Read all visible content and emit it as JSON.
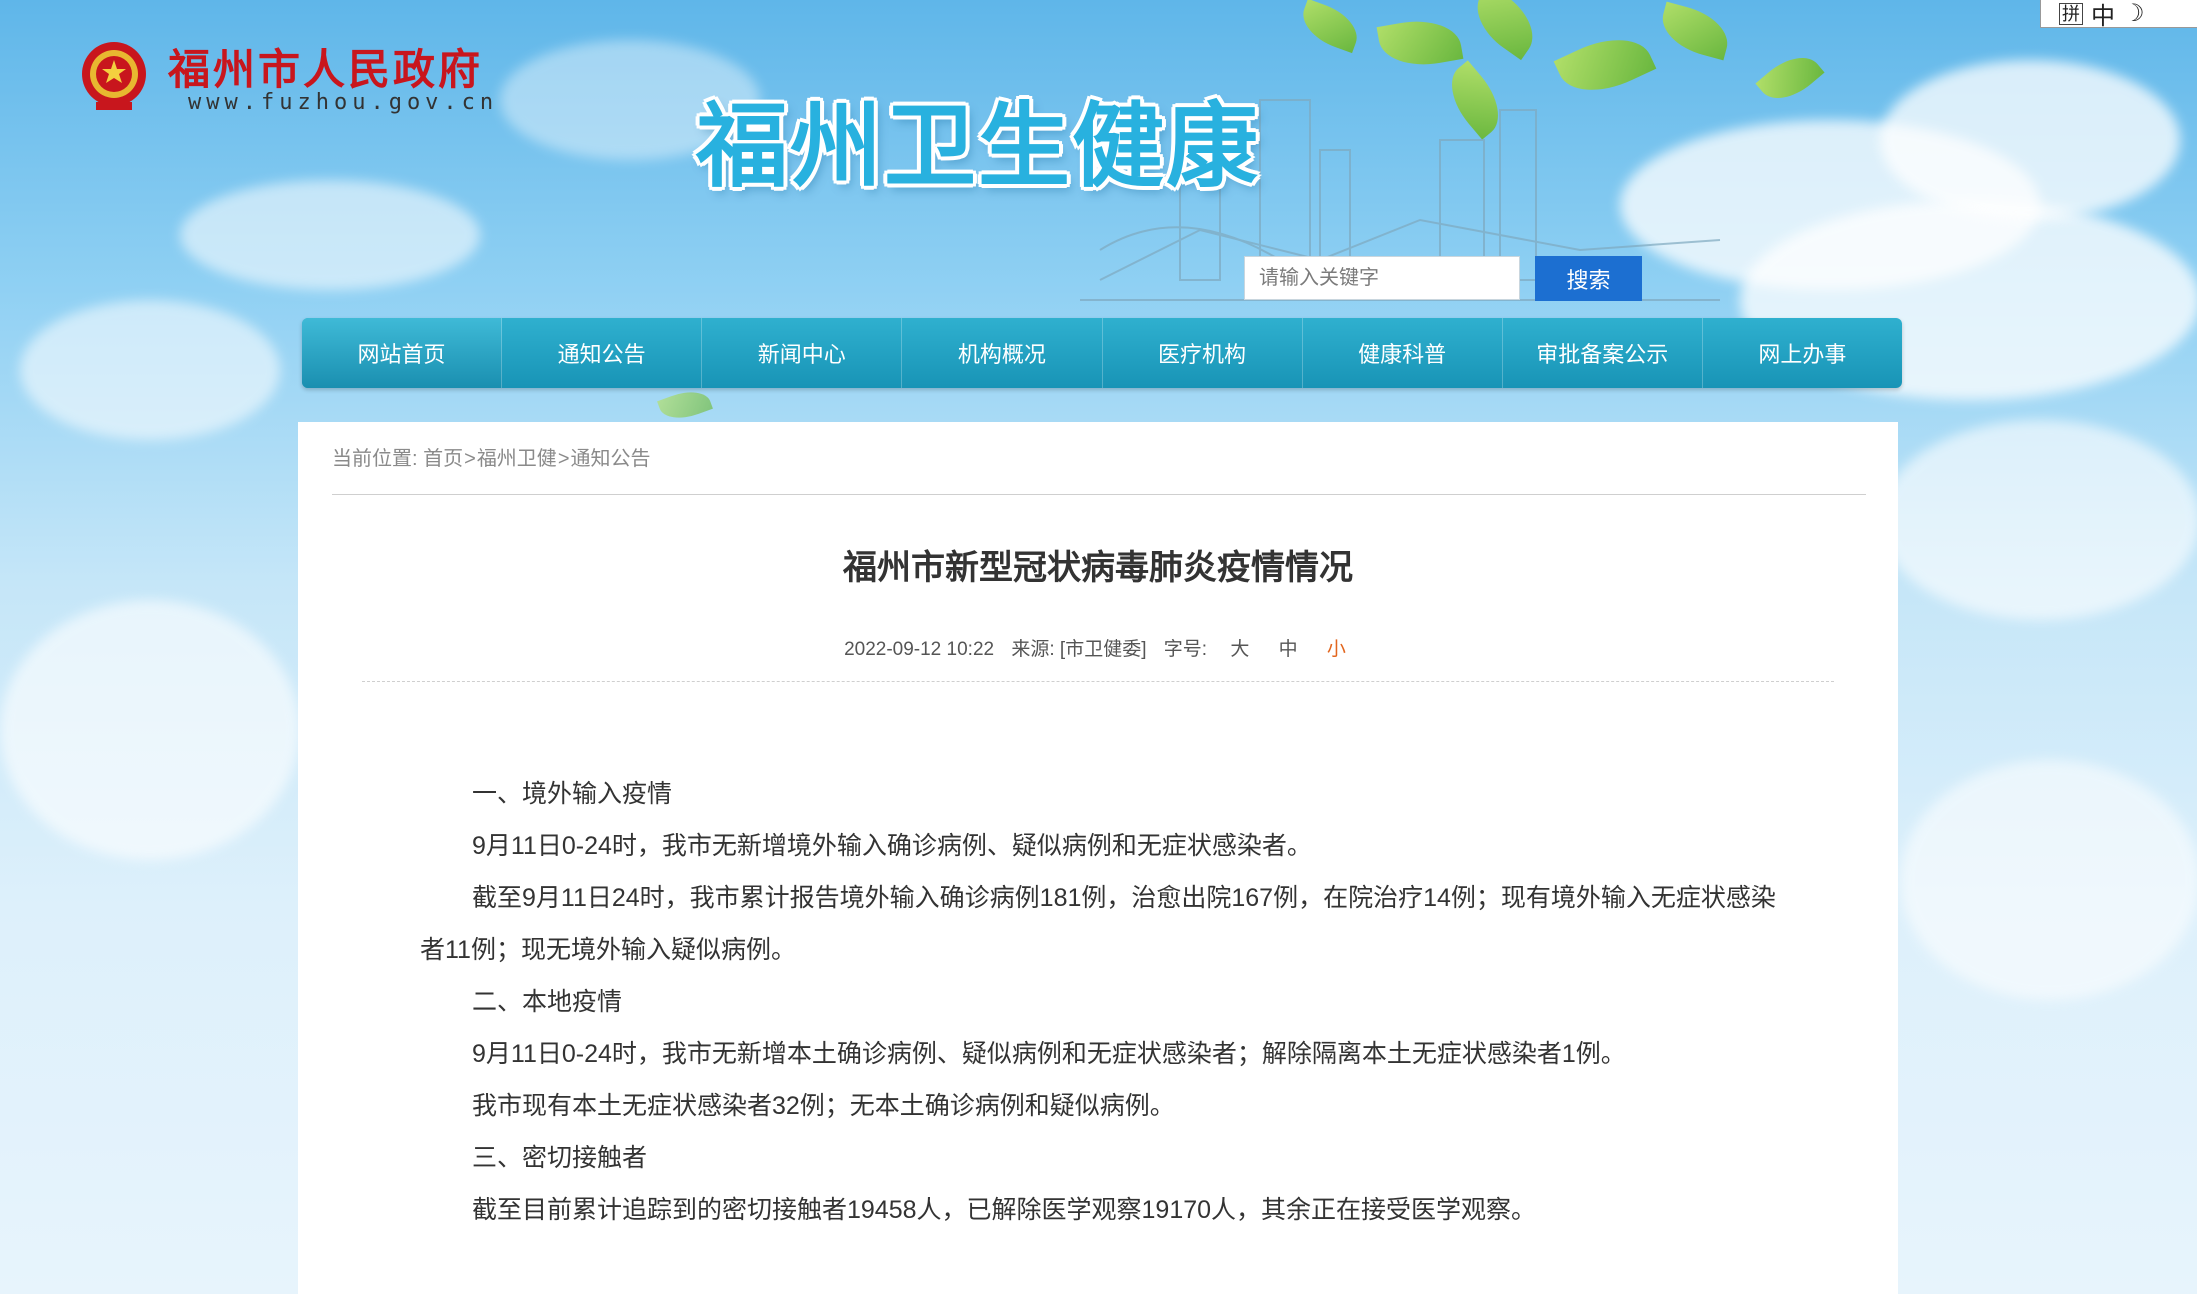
{
  "header": {
    "gov_title": "福州市人民政府",
    "gov_url": "www.fuzhou.gov.cn",
    "site_title": "福州卫生健康"
  },
  "search": {
    "placeholder": "请输入关键字",
    "button_label": "搜索"
  },
  "nav": {
    "items": [
      {
        "label": "网站首页"
      },
      {
        "label": "通知公告"
      },
      {
        "label": "新闻中心"
      },
      {
        "label": "机构概况"
      },
      {
        "label": "医疗机构"
      },
      {
        "label": "健康科普"
      },
      {
        "label": "审批备案公示"
      },
      {
        "label": "网上办事"
      }
    ]
  },
  "breadcrumb": {
    "prefix": "当前位置:",
    "items": [
      "首页",
      "福州卫健",
      "通知公告"
    ],
    "separator": ">"
  },
  "article": {
    "title": "福州市新型冠状病毒肺炎疫情情况",
    "date": "2022-09-12 10:22",
    "source": "来源: [市卫健委]",
    "font_size_label": "字号:",
    "font_sizes": [
      "大",
      "中",
      "小"
    ],
    "current_font_size": "小",
    "paragraphs": [
      "一、境外输入疫情",
      "9月11日0-24时，我市无新增境外输入确诊病例、疑似病例和无症状感染者。",
      "截至9月11日24时，我市累计报告境外输入确诊病例181例，治愈出院167例，在院治疗14例；现有境外输入无症状感染者11例；现无境外输入疑似病例。",
      "二、本地疫情",
      "9月11日0-24时，我市无新增本土确诊病例、疑似病例和无症状感染者；解除隔离本土无症状感染者1例。",
      "我市现有本土无症状感染者32例；无本土确诊病例和疑似病例。",
      "三、密切接触者",
      "截至目前累计追踪到的密切接触者19458人，已解除医学观察19170人，其余正在接受医学观察。"
    ]
  },
  "ime": {
    "pin_label": "拼",
    "mode_label": "中"
  },
  "colors": {
    "gov_red": "#c8161d",
    "nav_teal": "#1894b6",
    "search_blue": "#1c6fd1",
    "title_cyan": "#28b1df",
    "current_size_orange": "#e2661e"
  }
}
